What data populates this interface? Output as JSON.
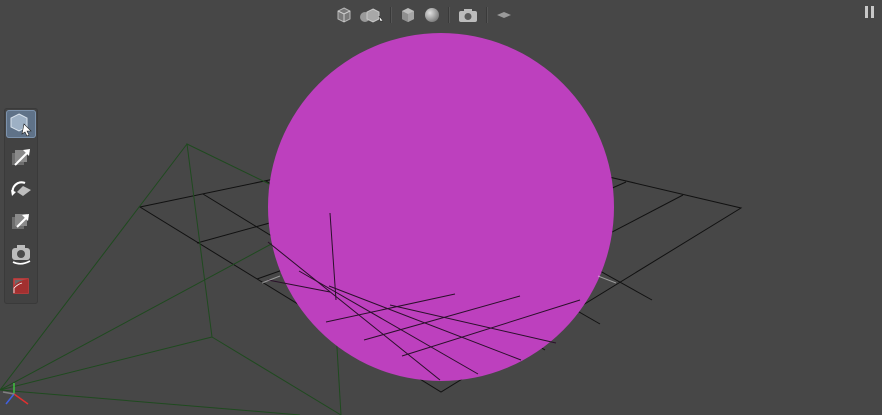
{
  "viewport": {
    "background": "#474747",
    "object": {
      "type": "sphere",
      "color": "#bd40be"
    },
    "grid": {
      "color": "#111111"
    },
    "camera_frustum": {
      "color": "#1f4a1f"
    },
    "axes": {
      "x_color": "#e03030",
      "y_color": "#40c040",
      "z_color": "#4060e0"
    }
  },
  "top_toolbar": {
    "items": [
      {
        "name": "wireframe-cube-icon"
      },
      {
        "name": "multi-object-icon"
      },
      {
        "name": "solid-cube-icon"
      },
      {
        "name": "shaded-sphere-icon"
      },
      {
        "name": "camera-icon"
      },
      {
        "name": "plane-toggle-icon"
      }
    ]
  },
  "pause": {
    "icon": "pause-icon"
  },
  "left_toolbar": {
    "tools": [
      {
        "name": "select-tool",
        "icon": "cube-cursor-icon",
        "active": true
      },
      {
        "name": "move-tool",
        "icon": "move-arrow-icon",
        "active": false
      },
      {
        "name": "rotate-tool",
        "icon": "rotate-arrow-icon",
        "active": false
      },
      {
        "name": "scale-tool",
        "icon": "scale-arrow-icon",
        "active": false
      },
      {
        "name": "camera-tool",
        "icon": "camera-orbit-icon",
        "active": false
      },
      {
        "name": "material-tool",
        "icon": "red-swatch-icon",
        "active": false
      }
    ]
  }
}
